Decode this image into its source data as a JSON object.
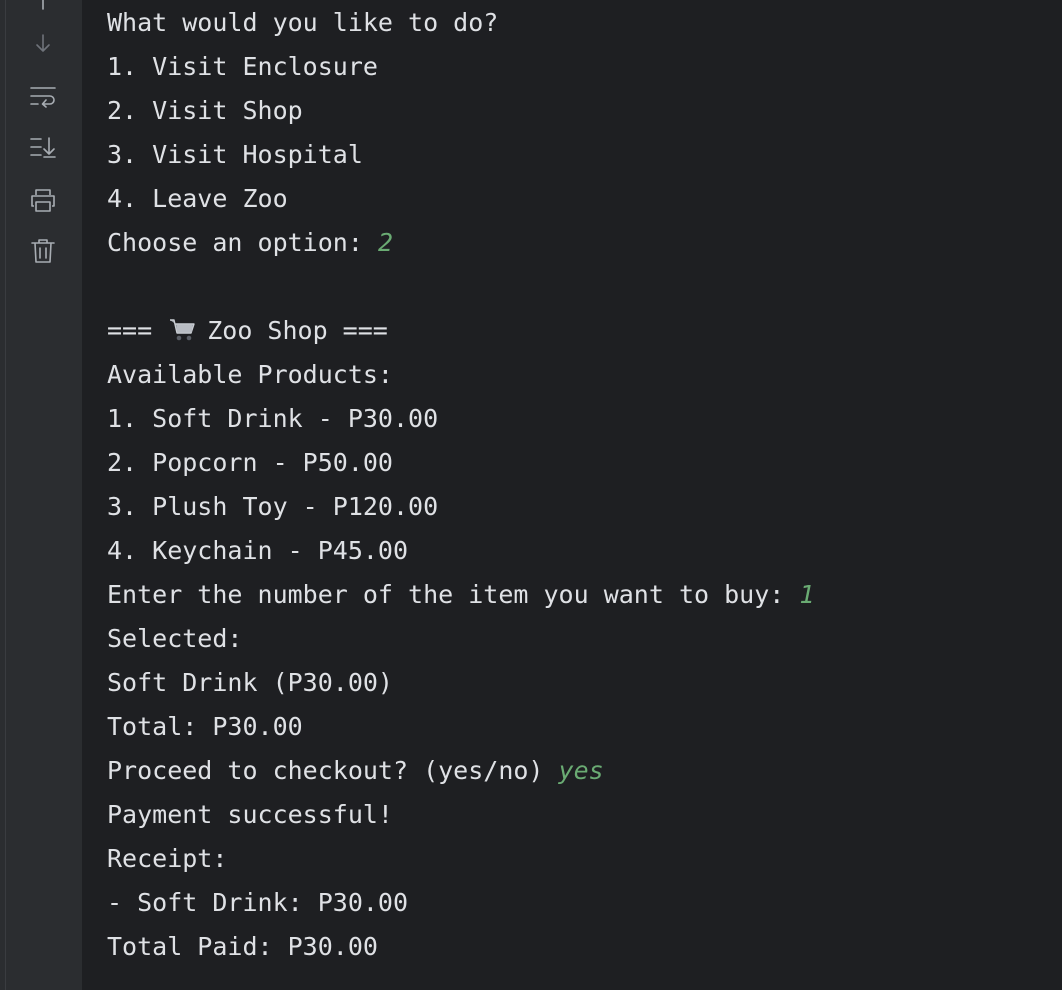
{
  "toolbar": {
    "icons": [
      "scroll-down-icon",
      "soft-wrap-icon",
      "scroll-to-end-icon",
      "print-icon",
      "clear-all-icon"
    ]
  },
  "colors": {
    "background": "#1e1f22",
    "toolbar_bg": "#2b2d30",
    "text": "#dfe1e5",
    "user_input": "#6aab73",
    "icon": "#a8adb3"
  },
  "console": {
    "prompt_action": "What would you like to do?",
    "menu": [
      "1. Visit Enclosure",
      "2. Visit Shop",
      "3. Visit Hospital",
      "4. Leave Zoo"
    ],
    "choose_prompt": "Choose an option: ",
    "choose_input": "2",
    "shop_header_left": "===",
    "shop_header_right": "Zoo Shop ===",
    "shop_icon": "shopping-cart-emoji",
    "available_label": "Available Products:",
    "products": [
      "1. Soft Drink - P30.00",
      "2. Popcorn - P50.00",
      "3. Plush Toy - P120.00",
      "4. Keychain - P45.00"
    ],
    "buy_prompt": "Enter the number of the item you want to buy: ",
    "buy_input": "1",
    "selected_label": "Selected:",
    "selected_item": "Soft Drink (P30.00)",
    "total": "Total: P30.00",
    "checkout_prompt": "Proceed to checkout? (yes/no) ",
    "checkout_input": "yes",
    "payment_status": "Payment successful!",
    "receipt_label": "Receipt:",
    "receipt_line": "- Soft Drink: P30.00",
    "total_paid": "Total Paid: P30.00"
  }
}
